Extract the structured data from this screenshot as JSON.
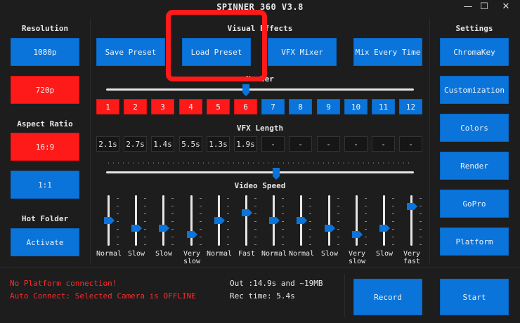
{
  "window": {
    "title": "SPINNER 360 V3.8",
    "minimize": "—",
    "maximize": "☐",
    "close": "✕"
  },
  "left": {
    "resolution_label": "Resolution",
    "res_1080": "1080p",
    "res_720": "720p",
    "aspect_label": "Aspect Ratio",
    "aspect_169": "16:9",
    "aspect_11": "1:1",
    "hotfolder_label": "Hot Folder",
    "activate": "Activate"
  },
  "center": {
    "visual_effects_label": "Visual Effects",
    "save_preset": "Save Preset",
    "load_preset": "Load Preset",
    "vfx_mixer": "VFX Mixer",
    "mix_every_time": "Mix Every Time",
    "number_label": "Number",
    "numbers": [
      "1",
      "2",
      "3",
      "4",
      "5",
      "6",
      "7",
      "8",
      "9",
      "10",
      "11",
      "12"
    ],
    "selected_count": 6,
    "vfx_length_label": "VFX Length",
    "vfx_lengths": [
      "2.1s",
      "2.7s",
      "1.4s",
      "5.5s",
      "1.3s",
      "1.9s",
      "-",
      "-",
      "-",
      "-",
      "-",
      "-"
    ],
    "video_speed_label": "Video Speed",
    "speed_labels": [
      "Normal",
      "Slow",
      "Slow",
      "Very\nslow",
      "Normal",
      "Fast",
      "Normal",
      "Normal",
      "Slow",
      "Very\nslow",
      "Slow",
      "Very\nfast"
    ],
    "speed_levels": [
      0.5,
      0.33,
      0.33,
      0.17,
      0.5,
      0.67,
      0.5,
      0.5,
      0.33,
      0.17,
      0.33,
      0.83
    ]
  },
  "right": {
    "settings_label": "Settings",
    "chromakey": "ChromaKey",
    "customization": "Customization",
    "colors": "Colors",
    "render": "Render",
    "gopro": "GoPro",
    "platform": "Platform"
  },
  "status": {
    "no_platform": "No Platform connection!",
    "auto_connect": "Auto Connect: Selected Camera is OFFLINE",
    "out": "Out :14.9s and ~19MB",
    "rec_time": "Rec time: 5.4s"
  },
  "bottom": {
    "record": "Record",
    "start": "Start"
  },
  "colors": {
    "accent": "#0a74da",
    "active": "#ff1a1a",
    "background": "#1d1d1d"
  }
}
